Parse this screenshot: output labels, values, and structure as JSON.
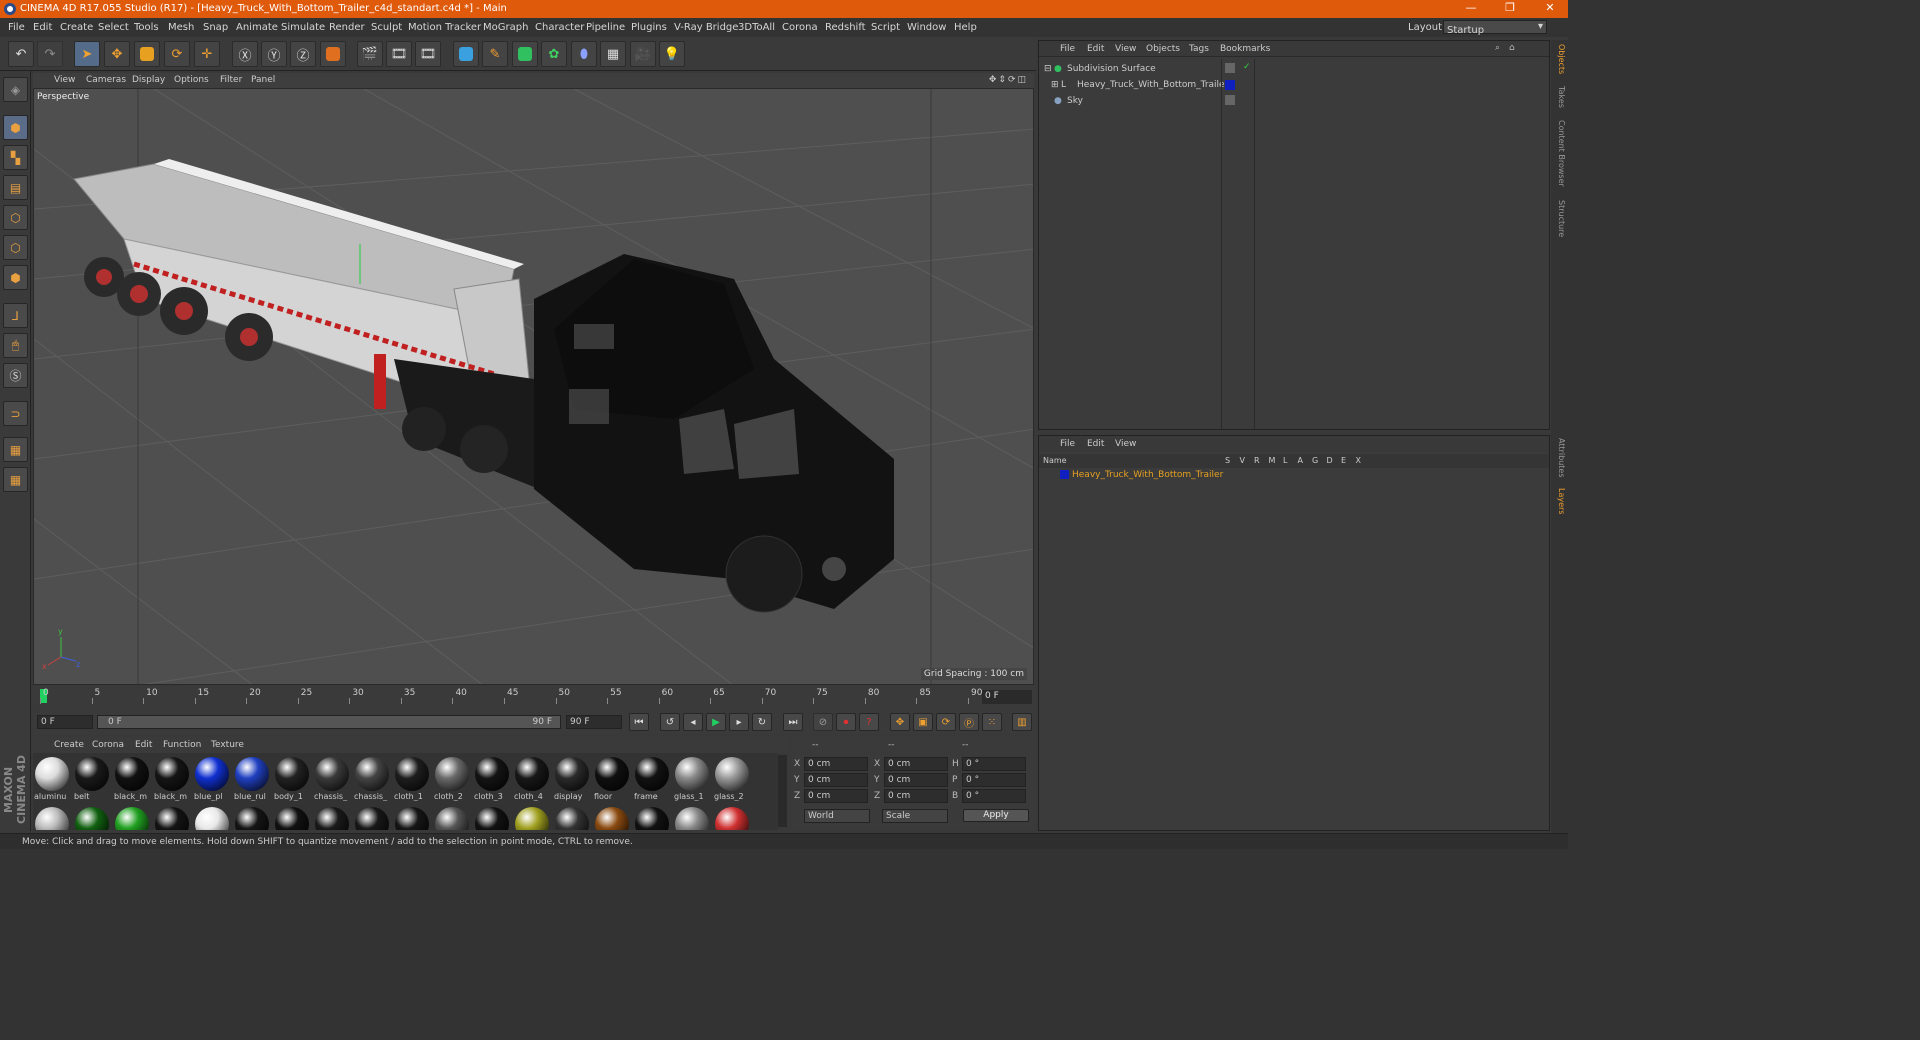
{
  "window": {
    "title": "CINEMA 4D R17.055 Studio (R17) - [Heavy_Truck_With_Bottom_Trailer_c4d_standart.c4d *] - Main",
    "minimize": "—",
    "maximize": "❐",
    "close": "✕"
  },
  "menubar": {
    "items": [
      "File",
      "Edit",
      "Create",
      "Select",
      "Tools",
      "Mesh",
      "Snap",
      "Animate",
      "Simulate",
      "Render",
      "Sculpt",
      "Motion Tracker",
      "MoGraph",
      "Character",
      "Pipeline",
      "Plugins",
      "V-Ray Bridge",
      "3DToAll",
      "Corona",
      "Redshift",
      "Script",
      "Window",
      "Help"
    ],
    "layout_label": "Layout:",
    "layout_value": "Startup"
  },
  "viewport": {
    "menu": [
      "View",
      "Cameras",
      "Display",
      "Options",
      "Filter",
      "Panel"
    ],
    "camera": "Perspective",
    "grid_spacing": "Grid Spacing : 100 cm"
  },
  "timeline": {
    "ticks": [
      "0",
      "5",
      "10",
      "15",
      "20",
      "25",
      "30",
      "35",
      "40",
      "45",
      "50",
      "55",
      "60",
      "65",
      "70",
      "75",
      "80",
      "85",
      "90"
    ],
    "current_frame": "0 F"
  },
  "transport": {
    "start": "0 F",
    "range_start": "0 F",
    "range_end": "90 F",
    "end": "90 F"
  },
  "materials": {
    "menu": [
      "Create",
      "Corona",
      "Edit",
      "Function",
      "Texture"
    ],
    "row1": [
      {
        "label": "aluminu",
        "color": "#dcdcdc"
      },
      {
        "label": "belt",
        "color": "#1a1a1a"
      },
      {
        "label": "black_m",
        "color": "#111111"
      },
      {
        "label": "black_m",
        "color": "#151515"
      },
      {
        "label": "blue_pl",
        "color": "#1030d0"
      },
      {
        "label": "blue_rul",
        "color": "#2040c0"
      },
      {
        "label": "body_1",
        "color": "#222222"
      },
      {
        "label": "chassis_",
        "color": "#3a3a3a"
      },
      {
        "label": "chassis_",
        "color": "#444444"
      },
      {
        "label": "cloth_1",
        "color": "#1e1e1e"
      },
      {
        "label": "cloth_2",
        "color": "#6a6a6a"
      },
      {
        "label": "cloth_3",
        "color": "#141414"
      },
      {
        "label": "cloth_4",
        "color": "#181818"
      },
      {
        "label": "display",
        "color": "#2a2a2a"
      },
      {
        "label": "floor",
        "color": "#101010"
      },
      {
        "label": "frame",
        "color": "#121212"
      },
      {
        "label": "glass_1",
        "color": "#8a8a8a"
      },
      {
        "label": "glass_2",
        "color": "#9a9a9a"
      }
    ],
    "row2": [
      {
        "color": "#bbbbbb"
      },
      {
        "color": "#106010"
      },
      {
        "color": "#20a020"
      },
      {
        "color": "#141414"
      },
      {
        "color": "#e8e8e8"
      },
      {
        "color": "#151515"
      },
      {
        "color": "#111111"
      },
      {
        "color": "#1a1a1a"
      },
      {
        "color": "#181818"
      },
      {
        "color": "#161616"
      },
      {
        "color": "#555555"
      },
      {
        "color": "#121212"
      },
      {
        "color": "#a0a020"
      },
      {
        "color": "#333333"
      },
      {
        "color": "#8a4a10"
      },
      {
        "color": "#111111"
      },
      {
        "color": "#888888"
      },
      {
        "color": "#d03030"
      }
    ]
  },
  "coords": {
    "headers": [
      "--",
      "--",
      "--"
    ],
    "rows": [
      {
        "a": "X",
        "av": "0 cm",
        "b": "X",
        "bv": "0 cm",
        "c": "H",
        "cv": "0 °"
      },
      {
        "a": "Y",
        "av": "0 cm",
        "b": "Y",
        "bv": "0 cm",
        "c": "P",
        "cv": "0 °"
      },
      {
        "a": "Z",
        "av": "0 cm",
        "b": "Z",
        "bv": "0 cm",
        "c": "B",
        "cv": "0 °"
      }
    ],
    "world": "World",
    "scale": "Scale",
    "apply": "Apply"
  },
  "objects": {
    "menu": [
      "File",
      "Edit",
      "View",
      "Objects",
      "Tags",
      "Bookmarks"
    ],
    "items": [
      "Subdivision Surface",
      "Heavy_Truck_With_Bottom_Trailer",
      "Sky"
    ]
  },
  "layers": {
    "menu": [
      "File",
      "Edit",
      "View"
    ],
    "columns": {
      "name": "Name",
      "flags": [
        "S",
        "V",
        "R",
        "M",
        "L",
        "A",
        "G",
        "D",
        "E",
        "X"
      ]
    },
    "row": "Heavy_Truck_With_Bottom_Trailer"
  },
  "right_tabs": [
    "Objects",
    "Takes",
    "Content Browser",
    "Structure",
    "Attributes",
    "Layers"
  ],
  "status": "Move: Click and drag to move elements. Hold down SHIFT to quantize movement / add to the selection in point mode, CTRL to remove.",
  "brand": "MAXON CINEMA 4D"
}
